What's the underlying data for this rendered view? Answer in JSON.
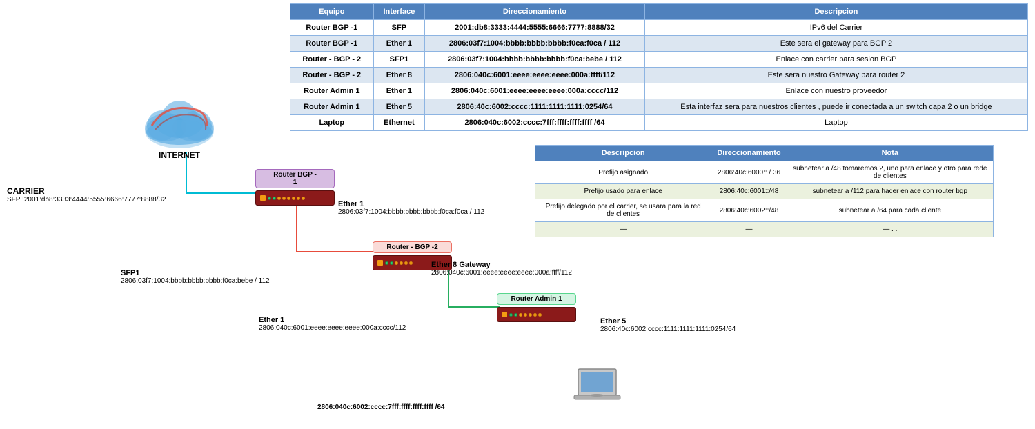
{
  "table": {
    "headers": [
      "Equipo",
      "Interface",
      "Direccionamiento",
      "Descripcion"
    ],
    "rows": [
      {
        "equipo": "Router BGP -1",
        "interface": "SFP",
        "direccionamiento": "2001:db8:3333:4444:5555:6666:7777:8888/32",
        "descripcion": "IPv6 del Carrier"
      },
      {
        "equipo": "Router BGP -1",
        "interface": "Ether 1",
        "direccionamiento": "2806:03f7:1004:bbbb:bbbb:bbbb:f0ca:f0ca / 112",
        "descripcion": "Este sera el gateway para BGP 2"
      },
      {
        "equipo": "Router - BGP - 2",
        "interface": "SFP1",
        "direccionamiento": "2806:03f7:1004:bbbb:bbbb:bbbb:f0ca:bebe / 112",
        "descripcion": "Enlace con carrier para sesion BGP"
      },
      {
        "equipo": "Router - BGP - 2",
        "interface": "Ether 8",
        "direccionamiento": "2806:040c:6001:eeee:eeee:eeee:000a:ffff/112",
        "descripcion": "Este sera nuestro Gateway para router 2"
      },
      {
        "equipo": "Router Admin 1",
        "interface": "Ether 1",
        "direccionamiento": "2806:040c:6001:eeee:eeee:eeee:000a:cccc/112",
        "descripcion": "Enlace con nuestro proveedor"
      },
      {
        "equipo": "Router Admin 1",
        "interface": "Ether 5",
        "direccionamiento": "2806:40c:6002:cccc:1111:1111:1111:0254/64",
        "descripcion": "Esta interfaz sera para nuestros clientes , puede ir conectada a un switch capa 2 o un bridge"
      },
      {
        "equipo": "Laptop",
        "interface": "Ethernet",
        "direccionamiento": "2806:040c:6002:cccc:7fff:ffff:ffff:ffff /64",
        "descripcion": "Laptop"
      }
    ]
  },
  "secondary_table": {
    "headers": [
      "Descripcion",
      "Direccionamiento",
      "Nota"
    ],
    "rows": [
      {
        "descripcion": "Prefijo asignado",
        "direccionamiento": "2806:40c:6000:: / 36",
        "nota": "subnetear a /48  tomaremos 2, uno para enlace y otro para rede de clientes"
      },
      {
        "descripcion": "Prefijo usado para enlace",
        "direccionamiento": "2806:40c:6001::/48",
        "nota": "subnetear a /112 para hacer enlace con router bgp"
      },
      {
        "descripcion": "Prefijo delegado por el carrier, se usara para la red de clientes",
        "direccionamiento": "2806:40c:6002::/48",
        "nota": "subnetear a /64 para cada cliente"
      },
      {
        "descripcion": "—",
        "direccionamiento": "—",
        "nota": "— . ."
      }
    ]
  },
  "diagram": {
    "internet_label": "INTERNET",
    "carrier_label": "CARRIER",
    "carrier_sfp": "SFP :2001:db8:3333:4444:5555:6666:7777:8888/32",
    "router_bgp1_label": "Router BGP -\n1",
    "router_bgp1_ether1_label": "Ether 1",
    "router_bgp1_ether1_addr": "2806:03f7:1004:bbbb:bbbb:bbbb:f0ca:f0ca / 112",
    "router_bgp2_label": "Router - BGP -2",
    "router_bgp2_sfp1_label": "SFP1",
    "router_bgp2_sfp1_addr": "2806:03f7:1004:bbbb:bbbb:bbbb:f0ca:bebe / 112",
    "router_bgp2_ether8_label": "Ether 8 Gateway",
    "router_bgp2_ether8_addr": "2806:040c:6001:eeee:eeee:eeee:000a:ffff/112",
    "router_admin1_label": "Router Admin 1",
    "router_admin1_ether1_label": "Ether 1",
    "router_admin1_ether1_addr": "2806:040c:6001:eeee:eeee:eeee:000a:cccc/112",
    "router_admin1_ether5_label": "Ether 5",
    "router_admin1_ether5_addr": "2806:40c:6002:cccc:1111:1111:1111:0254/64",
    "laptop_addr": "2806:040c:6002:cccc:7fff:ffff:ffff:ffff /64"
  }
}
